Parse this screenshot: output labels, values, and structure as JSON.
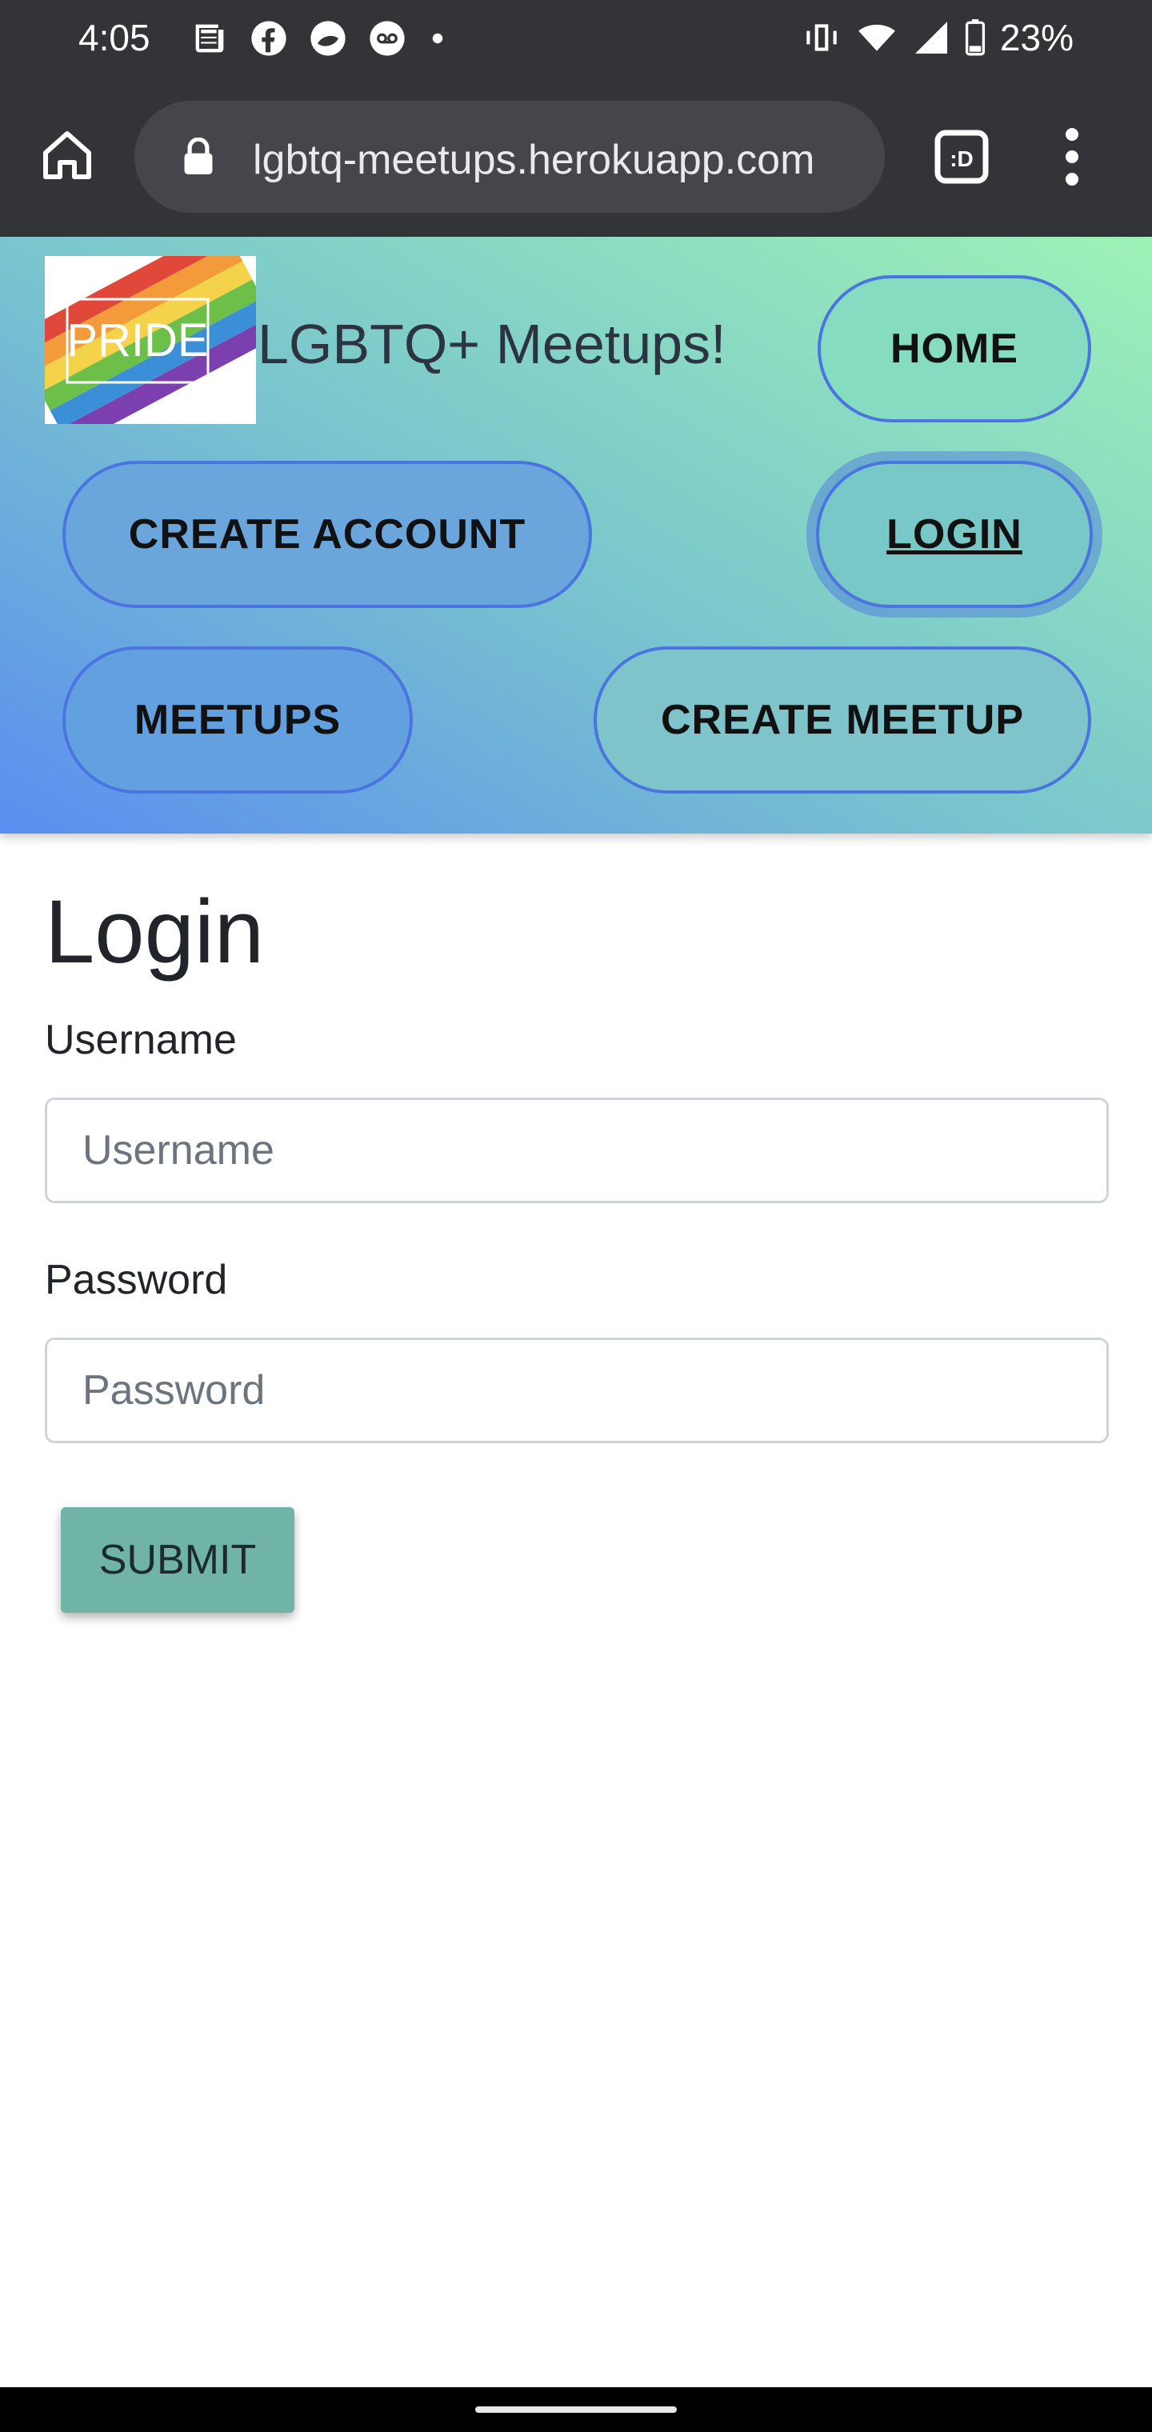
{
  "status_bar": {
    "time": "4:05",
    "battery": "23%",
    "notification_icons": [
      "news-icon",
      "facebook-icon",
      "app-icon",
      "voicemail-icon",
      "dot-icon"
    ]
  },
  "browser": {
    "url": "lgbtq-meetups.herokuapp.com",
    "tabs_label": ":D"
  },
  "site": {
    "logo_text": "PRIDE",
    "brand": "LGBTQ+ Meetups!",
    "nav": {
      "home": "HOME",
      "create_account": "CREATE ACCOUNT",
      "login": "LOGIN",
      "meetups": "MEETUPS",
      "create_meetup": "CREATE MEETUP"
    }
  },
  "login_form": {
    "title": "Login",
    "username_label": "Username",
    "username_placeholder": "Username",
    "password_label": "Password",
    "password_placeholder": "Password",
    "submit_label": "SUBMIT"
  },
  "colors": {
    "header_gradient_start": "#5b8df0",
    "header_gradient_end": "#9df2b6",
    "submit_button": "#6fb4a6",
    "browser_chrome": "#323438"
  }
}
